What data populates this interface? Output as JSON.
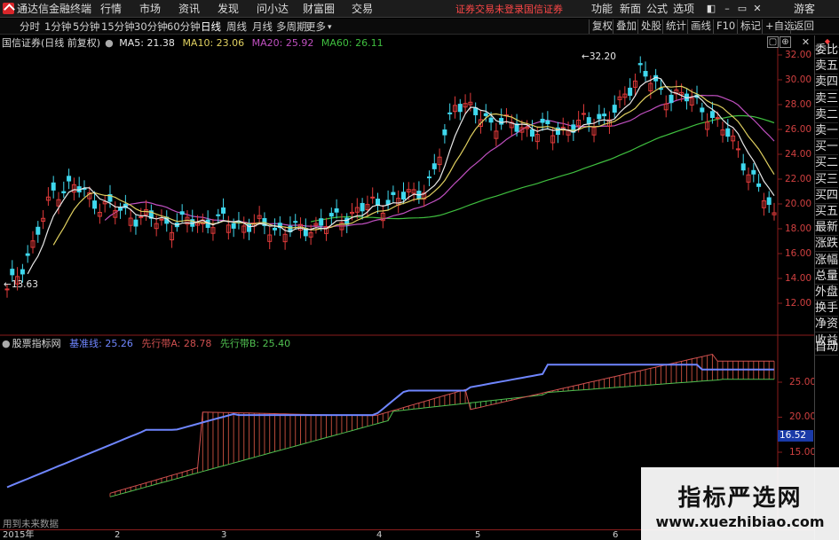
{
  "menubar": {
    "app_title": "通达信金融终端",
    "menu_items": [
      "行情",
      "市场",
      "资讯",
      "发现",
      "问小达",
      "财富圈",
      "交易"
    ],
    "notice_trade": "证券交易未登录",
    "notice_broker": "国信证券",
    "right_items": [
      "功能",
      "新面",
      "公式",
      "选项"
    ],
    "guest": "游客"
  },
  "toolbar": {
    "periods": [
      "分时",
      "1分钟",
      "5分钟",
      "15分钟",
      "30分钟",
      "60分钟",
      "日线",
      "周线",
      "月线",
      "多周期",
      "更多"
    ],
    "active_period": "日线",
    "right_buttons": [
      "复权",
      "叠加",
      "处股",
      "统计",
      "画线",
      "F10",
      "标记",
      "+自选",
      "返回"
    ]
  },
  "main_chart": {
    "title": "国信证券(日线 前复权)",
    "ma": [
      {
        "label": "MA5:",
        "value": "21.38",
        "color": "#e8e8e8"
      },
      {
        "label": "MA10:",
        "value": "23.06",
        "color": "#e0d060"
      },
      {
        "label": "MA20:",
        "value": "25.92",
        "color": "#c050c0"
      },
      {
        "label": "MA60:",
        "value": "26.11",
        "color": "#3fbf3f"
      }
    ],
    "high_label": "32.20",
    "low_label": "13.63",
    "price_ticks": [
      "32.00",
      "30.00",
      "28.00",
      "26.00",
      "24.00",
      "22.00",
      "20.00",
      "18.00",
      "16.00",
      "14.00",
      "12.00"
    ]
  },
  "indicator": {
    "title": "股票指标网",
    "lines": [
      {
        "label": "基准线:",
        "value": "25.26",
        "color": "#6f86ff"
      },
      {
        "label": "先行带A:",
        "value": "28.78",
        "color": "#d05050"
      },
      {
        "label": "先行带B:",
        "value": "25.40",
        "color": "#50c050"
      }
    ],
    "ticks": [
      "25.00",
      "20.00",
      "15.00"
    ],
    "current_value": "16.52",
    "footer_note": "用到未来数据"
  },
  "date_axis": {
    "labels": [
      "2015年",
      "2",
      "3",
      "4",
      "5",
      "6"
    ]
  },
  "sidebar": {
    "items": [
      "委比",
      "卖五",
      "卖四",
      "卖三",
      "卖二",
      "卖一",
      "买一",
      "买二",
      "买三",
      "买四",
      "买五",
      "最新",
      "涨跌",
      "涨幅",
      "总量",
      "外盘",
      "换手",
      "净资",
      "收益",
      "自动"
    ]
  },
  "watermark": {
    "cn": "指标严选网",
    "url": "www.xuezhibiao.com"
  },
  "colors": {
    "up": "#e03a3a",
    "down": "#3fd8ee",
    "ma5": "#e8e8e8",
    "ma10": "#e0d060",
    "ma20": "#c050c0",
    "ma60": "#3fbf3f",
    "base": "#6f86ff",
    "leadA": "#d05050",
    "leadB": "#50c050"
  }
}
